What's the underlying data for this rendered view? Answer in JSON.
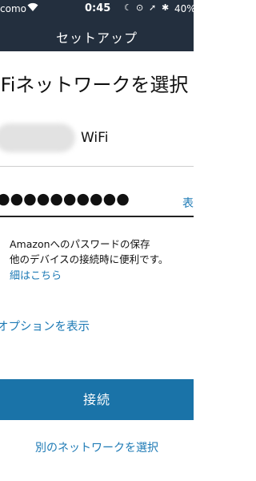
{
  "status_bar": {
    "carrier": "como",
    "time": "0:45",
    "battery": "40%"
  },
  "nav": {
    "title": "セットアップ"
  },
  "heading": "-Fiネットワークを選択",
  "network": {
    "name": "WiFi"
  },
  "password": {
    "masked": "●●●●●●●●●●",
    "show_label": "表"
  },
  "info": {
    "line1": "Amazonへのパスワードの保存",
    "line2": "他のデバイスの接続時に便利です。",
    "link": "細はこちら"
  },
  "advanced_options_label": "オプションを表示",
  "connect_button": "接続",
  "other_network_link": "別のネットワークを選択",
  "colors": {
    "header": "#232f3e",
    "accent": "#1a73a8",
    "link": "#1d7ab5"
  }
}
